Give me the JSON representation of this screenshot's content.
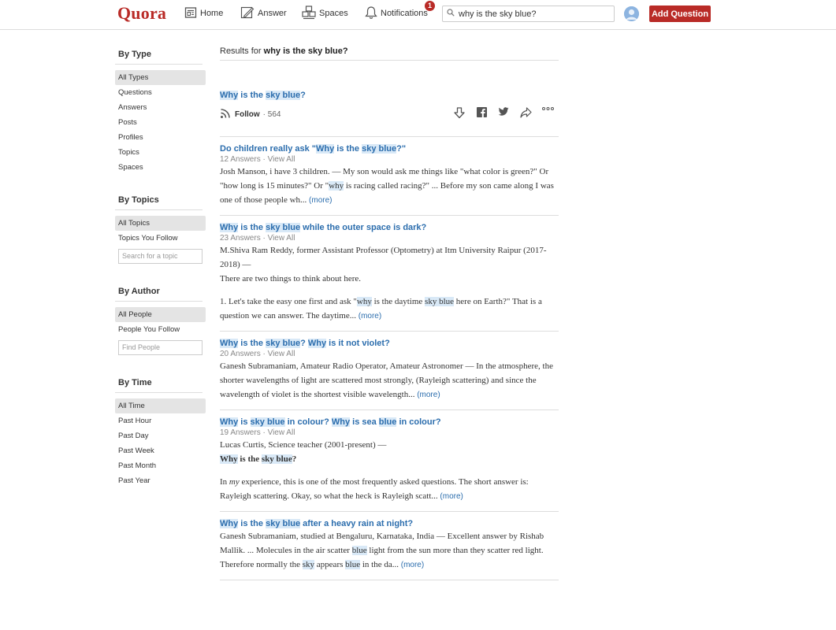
{
  "header": {
    "logo": "Quora",
    "nav": [
      {
        "label": "Home",
        "icon": "home-icon"
      },
      {
        "label": "Answer",
        "icon": "answer-icon"
      },
      {
        "label": "Spaces",
        "icon": "spaces-icon"
      },
      {
        "label": "Notifications",
        "icon": "bell-icon",
        "badge": "1"
      }
    ],
    "search_value": "why is the sky blue?",
    "add_question_label": "Add Question"
  },
  "sidebar": {
    "groups": [
      {
        "heading": "By Type",
        "items": [
          "All Types",
          "Questions",
          "Answers",
          "Posts",
          "Profiles",
          "Topics",
          "Spaces"
        ],
        "active": "All Types"
      },
      {
        "heading": "By Topics",
        "items": [
          "All Topics",
          "Topics You Follow"
        ],
        "active": "All Topics",
        "input_placeholder": "Search for a topic"
      },
      {
        "heading": "By Author",
        "items": [
          "All People",
          "People You Follow"
        ],
        "active": "All People",
        "input_placeholder": "Find People"
      },
      {
        "heading": "By Time",
        "items": [
          "All Time",
          "Past Hour",
          "Past Day",
          "Past Week",
          "Past Month",
          "Past Year"
        ],
        "active": "All Time"
      }
    ]
  },
  "main": {
    "results_for_label": "Results for",
    "query": "why is the sky blue?",
    "featured": {
      "title": [
        {
          "t": "Why",
          "h": true
        },
        {
          "t": " is the "
        },
        {
          "t": "sky blue",
          "h": true
        },
        {
          "t": "?"
        }
      ],
      "follow_label": "Follow",
      "follow_count": "564"
    },
    "results": [
      {
        "title": [
          {
            "t": "Do children really ask \""
          },
          {
            "t": "Why",
            "h": true
          },
          {
            "t": " is the "
          },
          {
            "t": "sky blue",
            "h": true
          },
          {
            "t": "?\""
          }
        ],
        "meta": "12 Answers · View All",
        "paragraphs": [
          [
            {
              "t": "Josh Manson, i have 3 children. — My son would ask me things like \"what color is green?\" Or \"how long is 15 minutes?\" Or \""
            },
            {
              "t": "why",
              "h": true
            },
            {
              "t": " is racing called racing?\" ... Before my son came along I was one of those people wh... "
            },
            {
              "t": "(more)",
              "more": true
            }
          ]
        ]
      },
      {
        "title": [
          {
            "t": "Why",
            "h": true
          },
          {
            "t": " is the "
          },
          {
            "t": "sky blue",
            "h": true
          },
          {
            "t": " while the outer space is dark?"
          }
        ],
        "meta": "23 Answers · View All",
        "paragraphs": [
          [
            {
              "t": "M.Shiva Ram Reddy, former Assistant Professor (Optometry) at Itm University Raipur (2017-2018) —"
            },
            {
              "br": true
            },
            {
              "t": "There are two things to think about here."
            }
          ],
          [
            {
              "t": "1. Let's take the easy one first and ask \""
            },
            {
              "t": "why",
              "h": true
            },
            {
              "t": " is the daytime "
            },
            {
              "t": "sky blue",
              "h": true
            },
            {
              "t": " here on Earth?\" That is a question we can answer. The daytime... "
            },
            {
              "t": "(more)",
              "more": true
            }
          ]
        ]
      },
      {
        "title": [
          {
            "t": "Why",
            "h": true
          },
          {
            "t": " is the "
          },
          {
            "t": "sky blue",
            "h": true
          },
          {
            "t": "? "
          },
          {
            "t": "Why",
            "h": true
          },
          {
            "t": " is it not violet?"
          }
        ],
        "meta": "20 Answers · View All",
        "paragraphs": [
          [
            {
              "t": "Ganesh Subramaniam, Amateur Radio Operator, Amateur Astronomer — In the atmosphere, the shorter wavelengths of light are scattered most strongly, (Rayleigh scattering) and since the wavelength of violet is the shortest visible wavelength... "
            },
            {
              "t": "(more)",
              "more": true
            }
          ]
        ]
      },
      {
        "title": [
          {
            "t": "Why",
            "h": true
          },
          {
            "t": " is "
          },
          {
            "t": "sky blue",
            "h": true
          },
          {
            "t": " in colour? "
          },
          {
            "t": "Why",
            "h": true
          },
          {
            "t": " is sea "
          },
          {
            "t": "blue",
            "h": true
          },
          {
            "t": " in colour?"
          }
        ],
        "meta": "19 Answers · View All",
        "paragraphs": [
          [
            {
              "t": "Lucas Curtis, Science teacher (2001-present) —"
            },
            {
              "br": true
            },
            {
              "t": "Why",
              "h": true,
              "b": true
            },
            {
              "t": " is the ",
              "b": true
            },
            {
              "t": "sky blue",
              "h": true,
              "b": true
            },
            {
              "t": "?",
              "b": true
            }
          ],
          [
            {
              "t": "In "
            },
            {
              "t": "my",
              "i": true
            },
            {
              "t": " experience, this is one of the most frequently asked questions. The short answer is: Rayleigh scattering. Okay, so what the heck is Rayleigh scatt... "
            },
            {
              "t": "(more)",
              "more": true
            }
          ]
        ]
      },
      {
        "title": [
          {
            "t": "Why",
            "h": true
          },
          {
            "t": " is the "
          },
          {
            "t": "sky blue",
            "h": true
          },
          {
            "t": " after a heavy rain at night?"
          }
        ],
        "meta": "",
        "paragraphs": [
          [
            {
              "t": "Ganesh Subramaniam, studied at Bengaluru, Karnataka, India — Excellent answer by Rishab Mallik. ... Molecules in the air scatter "
            },
            {
              "t": "blue",
              "h": true
            },
            {
              "t": " light from the sun more than they scatter red light. Therefore normally the "
            },
            {
              "t": "sky",
              "h": true
            },
            {
              "t": " appears "
            },
            {
              "t": "blue",
              "h": true
            },
            {
              "t": " in the da... "
            },
            {
              "t": "(more)",
              "more": true
            }
          ]
        ]
      }
    ]
  },
  "colors": {
    "brand": "#b92b27",
    "link": "#2b6dad",
    "highlight": "#d9e9f7"
  }
}
